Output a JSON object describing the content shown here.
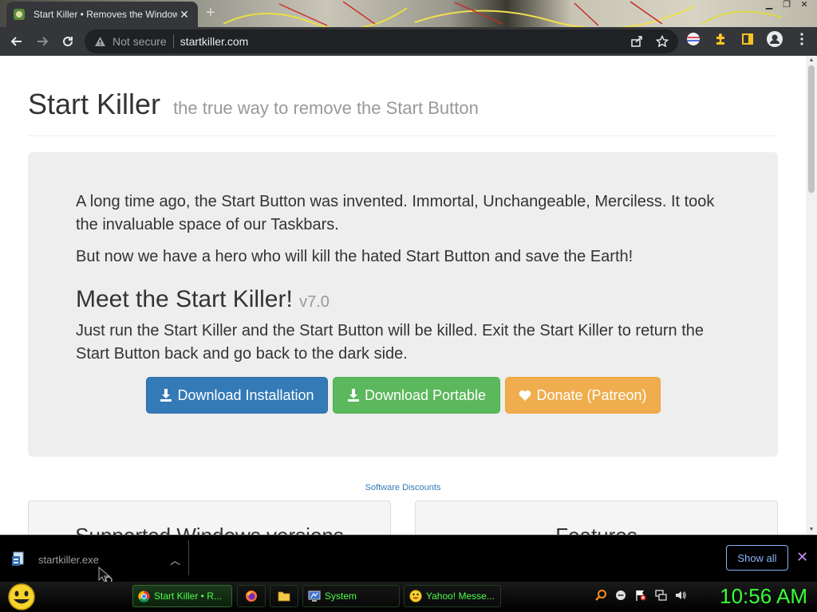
{
  "browser": {
    "tab_title": "Start Killer • Removes the Windows Start Button",
    "security_text": "Not secure",
    "url": "startkiller.com"
  },
  "page": {
    "title": "Start Killer",
    "subtitle": "the true way to remove the Start Button",
    "intro_p1": "A long time ago, the Start Button was invented. Immortal, Unchangeable, Merciless. It took the invaluable space of our Taskbars.",
    "intro_p2": "But now we have a hero who will kill the hated Start Button and save the Earth!",
    "meet_heading": "Meet the Start Killer!",
    "version": "v7.0",
    "run_text": "Just run the Start Killer and the Start Button will be killed. Exit the Start Killer to return the Start Button back and go back to the dark side.",
    "buttons": {
      "download_install": "Download Installation",
      "download_portable": "Download Portable",
      "donate": "Donate (Patreon)"
    },
    "software_discounts": "Software Discounts",
    "panel_left_title": "Supported Windows versions",
    "panel_right_title": "Features"
  },
  "downloads": {
    "file_name": "startkiller.exe",
    "show_all": "Show all"
  },
  "taskbar": {
    "items": [
      {
        "label": "Start Killer • R..."
      },
      {
        "label": "System"
      },
      {
        "label": "Yahoo! Messe..."
      }
    ],
    "clock": "10:56 AM"
  },
  "colors": {
    "primary": "#337ab7",
    "success": "#5cb85c",
    "warning": "#f0ad4e",
    "taskbar_text": "#4cff4c",
    "clock": "#36ff36"
  }
}
